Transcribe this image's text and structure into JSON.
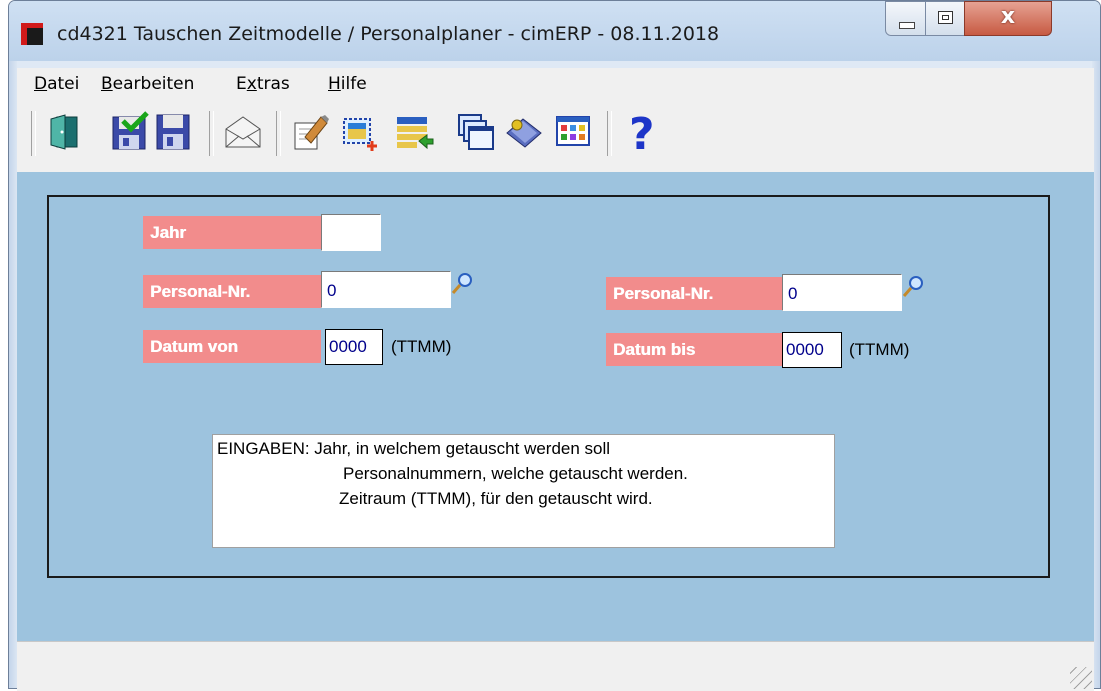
{
  "window": {
    "title": "cd4321 Tauschen Zeitmodelle / Personalplaner - cimERP - 08.11.2018",
    "controls": {
      "minimize_icon": "minimize-icon",
      "maximize_icon": "maximize-icon",
      "close_glyph": "x"
    }
  },
  "menu": {
    "items": [
      {
        "label": "Datei",
        "underline": "D",
        "rest": "atei"
      },
      {
        "label": "Bearbeiten",
        "underline": "B",
        "rest": "earbeiten"
      },
      {
        "label": "Extras",
        "pre": "E",
        "underline": "x",
        "rest": "tras"
      },
      {
        "label": "Hilfe",
        "underline": "H",
        "rest": "ilfe"
      }
    ]
  },
  "toolbar": {
    "icons": [
      "exit-door-icon",
      "save-check-icon",
      "save-icon",
      "mail-envelope-icon",
      "edit-document-icon",
      "new-selection-icon",
      "list-import-icon",
      "windows-cascade-icon",
      "book-tag-icon",
      "color-grid-icon",
      "help-question-icon"
    ]
  },
  "form": {
    "jahr": {
      "label": "Jahr",
      "value": ""
    },
    "personal_nr_left": {
      "label": "Personal-Nr.",
      "value": "0"
    },
    "personal_nr_right": {
      "label": "Personal-Nr.",
      "value": "0"
    },
    "datum_von": {
      "label": "Datum von",
      "value": "0000",
      "hint": "(TTMM)"
    },
    "datum_bis": {
      "label": "Datum bis",
      "value": "0000",
      "hint": "(TTMM)"
    },
    "info": {
      "line1": "EINGABEN:  Jahr, in welchem getauscht werden soll",
      "line2": "Personalnummern, welche getauscht werden.",
      "line3": "Zeitraum (TTMM), für den getauscht wird."
    }
  },
  "status": {
    "text": ""
  },
  "colors": {
    "content_bg": "#9dc3de",
    "label_bg": "#f28c8c",
    "field_text": "#00008b"
  }
}
